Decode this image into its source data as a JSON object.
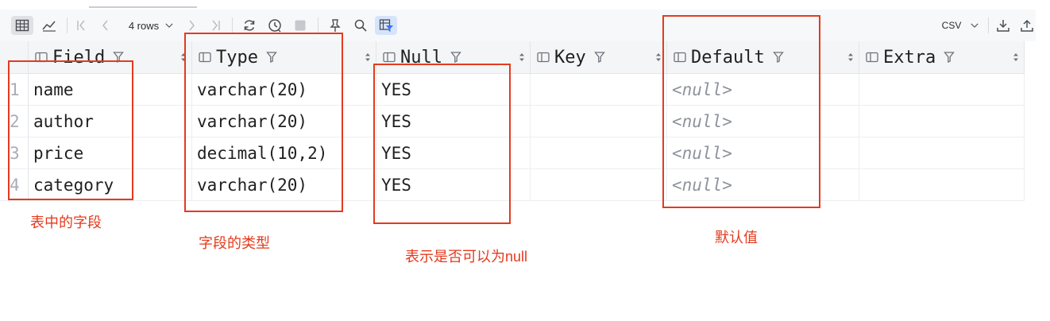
{
  "toolbar": {
    "rows_label": "4 rows",
    "export_format": "CSV"
  },
  "columns": [
    "Field",
    "Type",
    "Null",
    "Key",
    "Default",
    "Extra"
  ],
  "rows": [
    {
      "num": "1",
      "field": "name",
      "type": "varchar(20)",
      "null": "YES",
      "key": "",
      "default": "<null>",
      "extra": ""
    },
    {
      "num": "2",
      "field": "author",
      "type": "varchar(20)",
      "null": "YES",
      "key": "",
      "default": "<null>",
      "extra": ""
    },
    {
      "num": "3",
      "field": "price",
      "type": "decimal(10,2)",
      "null": "YES",
      "key": "",
      "default": "<null>",
      "extra": ""
    },
    {
      "num": "4",
      "field": "category",
      "type": "varchar(20)",
      "null": "YES",
      "key": "",
      "default": "<null>",
      "extra": ""
    }
  ],
  "annotations": {
    "field_note": "表中的字段",
    "type_note": "字段的类型",
    "null_note": "表示是否可以为null",
    "default_note": "默认值"
  },
  "colors": {
    "annotation": "#e33b1e",
    "accent": "#3574f0"
  }
}
